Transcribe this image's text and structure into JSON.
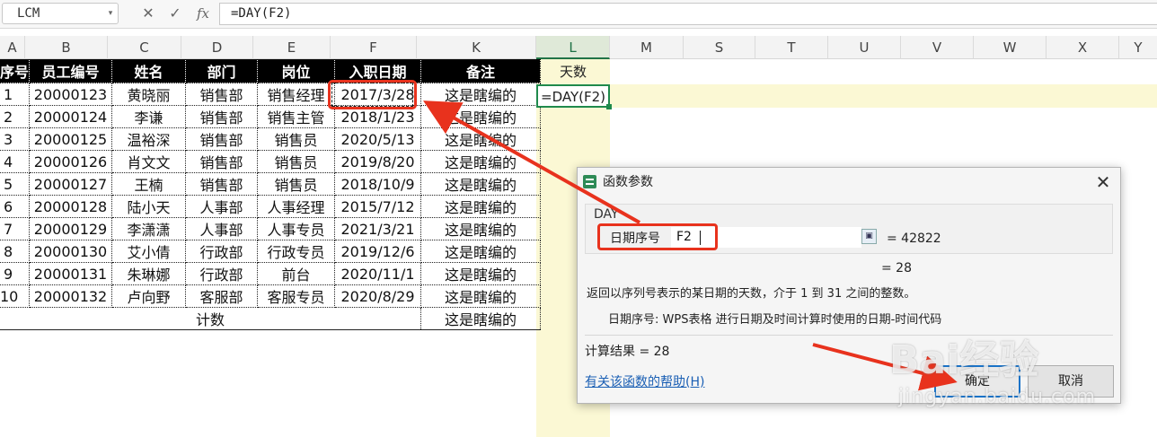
{
  "formula_bar": {
    "name_box": "LCM",
    "cancel_icon": "✕",
    "confirm_icon": "✓",
    "fx_label": "fx",
    "formula": "=DAY(F2)"
  },
  "columns": [
    "A",
    "B",
    "C",
    "D",
    "E",
    "F",
    "K",
    "L",
    "M",
    "S",
    "T",
    "U",
    "V",
    "W",
    "X",
    "Y"
  ],
  "table": {
    "headers": [
      "序号",
      "员工编号",
      "姓名",
      "部门",
      "岗位",
      "入职日期",
      "备注"
    ],
    "rows": [
      [
        "1",
        "20000123",
        "黄晓丽",
        "销售部",
        "销售经理",
        "2017/3/28",
        "这是瞎编的"
      ],
      [
        "2",
        "20000124",
        "李谦",
        "销售部",
        "销售主管",
        "2018/1/23",
        "这是瞎编的"
      ],
      [
        "3",
        "20000125",
        "温裕深",
        "销售部",
        "销售员",
        "2020/5/13",
        "这是瞎编的"
      ],
      [
        "4",
        "20000126",
        "肖文文",
        "销售部",
        "销售员",
        "2019/8/20",
        "这是瞎编的"
      ],
      [
        "5",
        "20000127",
        "王楠",
        "销售部",
        "销售员",
        "2018/10/9",
        "这是瞎编的"
      ],
      [
        "6",
        "20000128",
        "陆小天",
        "人事部",
        "人事经理",
        "2015/7/12",
        "这是瞎编的"
      ],
      [
        "7",
        "20000129",
        "李潇潇",
        "人事部",
        "人事专员",
        "2021/3/21",
        "这是瞎编的"
      ],
      [
        "8",
        "20000130",
        "艾小倩",
        "行政部",
        "行政专员",
        "2019/12/6",
        "这是瞎编的"
      ],
      [
        "9",
        "20000131",
        "朱琳娜",
        "行政部",
        "前台",
        "2020/11/1",
        "这是瞎编的"
      ],
      [
        "10",
        "20000132",
        "卢向野",
        "客服部",
        "客服专员",
        "2020/8/29",
        "这是瞎编的"
      ]
    ],
    "footer_label": "计数",
    "footer_note": "这是瞎编的"
  },
  "column_l": {
    "header": "天数",
    "active_cell": "=DAY(F2)"
  },
  "dialog": {
    "title": "函数参数",
    "close_icon": "✕",
    "function_name": "DAY",
    "arg_label": "日期序号",
    "arg_value": "F2",
    "arg_result": "= 42822",
    "result": "= 28",
    "description": "返回以序列号表示的某日期的天数，介于 1 到 31 之间的整数。",
    "arg_description": "日期序号:  WPS表格 进行日期及时间计算时使用的日期-时间代码",
    "calc_result": "计算结果 = 28",
    "help_link": "有关该函数的帮助(H)",
    "ok_label": "确定",
    "cancel_label": "取消"
  },
  "watermark": {
    "brand": "Bai经验",
    "url": "jingyan.baidu.com"
  },
  "colors": {
    "accent_green": "#217346",
    "annotation_red": "#e8321d",
    "column_highlight": "#fbf8d4",
    "header_black": "#000000"
  }
}
